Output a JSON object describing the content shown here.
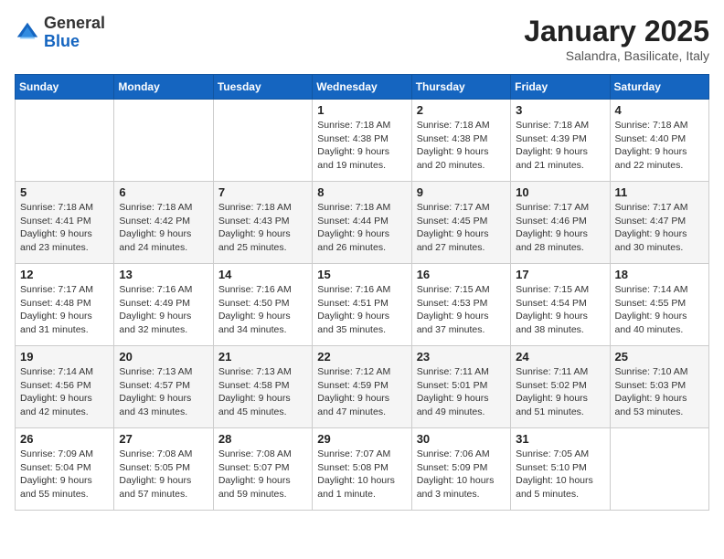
{
  "logo": {
    "general": "General",
    "blue": "Blue"
  },
  "title": "January 2025",
  "subtitle": "Salandra, Basilicate, Italy",
  "days_of_week": [
    "Sunday",
    "Monday",
    "Tuesday",
    "Wednesday",
    "Thursday",
    "Friday",
    "Saturday"
  ],
  "weeks": [
    [
      {
        "day": "",
        "info": ""
      },
      {
        "day": "",
        "info": ""
      },
      {
        "day": "",
        "info": ""
      },
      {
        "day": "1",
        "info": "Sunrise: 7:18 AM\nSunset: 4:38 PM\nDaylight: 9 hours\nand 19 minutes."
      },
      {
        "day": "2",
        "info": "Sunrise: 7:18 AM\nSunset: 4:38 PM\nDaylight: 9 hours\nand 20 minutes."
      },
      {
        "day": "3",
        "info": "Sunrise: 7:18 AM\nSunset: 4:39 PM\nDaylight: 9 hours\nand 21 minutes."
      },
      {
        "day": "4",
        "info": "Sunrise: 7:18 AM\nSunset: 4:40 PM\nDaylight: 9 hours\nand 22 minutes."
      }
    ],
    [
      {
        "day": "5",
        "info": "Sunrise: 7:18 AM\nSunset: 4:41 PM\nDaylight: 9 hours\nand 23 minutes."
      },
      {
        "day": "6",
        "info": "Sunrise: 7:18 AM\nSunset: 4:42 PM\nDaylight: 9 hours\nand 24 minutes."
      },
      {
        "day": "7",
        "info": "Sunrise: 7:18 AM\nSunset: 4:43 PM\nDaylight: 9 hours\nand 25 minutes."
      },
      {
        "day": "8",
        "info": "Sunrise: 7:18 AM\nSunset: 4:44 PM\nDaylight: 9 hours\nand 26 minutes."
      },
      {
        "day": "9",
        "info": "Sunrise: 7:17 AM\nSunset: 4:45 PM\nDaylight: 9 hours\nand 27 minutes."
      },
      {
        "day": "10",
        "info": "Sunrise: 7:17 AM\nSunset: 4:46 PM\nDaylight: 9 hours\nand 28 minutes."
      },
      {
        "day": "11",
        "info": "Sunrise: 7:17 AM\nSunset: 4:47 PM\nDaylight: 9 hours\nand 30 minutes."
      }
    ],
    [
      {
        "day": "12",
        "info": "Sunrise: 7:17 AM\nSunset: 4:48 PM\nDaylight: 9 hours\nand 31 minutes."
      },
      {
        "day": "13",
        "info": "Sunrise: 7:16 AM\nSunset: 4:49 PM\nDaylight: 9 hours\nand 32 minutes."
      },
      {
        "day": "14",
        "info": "Sunrise: 7:16 AM\nSunset: 4:50 PM\nDaylight: 9 hours\nand 34 minutes."
      },
      {
        "day": "15",
        "info": "Sunrise: 7:16 AM\nSunset: 4:51 PM\nDaylight: 9 hours\nand 35 minutes."
      },
      {
        "day": "16",
        "info": "Sunrise: 7:15 AM\nSunset: 4:53 PM\nDaylight: 9 hours\nand 37 minutes."
      },
      {
        "day": "17",
        "info": "Sunrise: 7:15 AM\nSunset: 4:54 PM\nDaylight: 9 hours\nand 38 minutes."
      },
      {
        "day": "18",
        "info": "Sunrise: 7:14 AM\nSunset: 4:55 PM\nDaylight: 9 hours\nand 40 minutes."
      }
    ],
    [
      {
        "day": "19",
        "info": "Sunrise: 7:14 AM\nSunset: 4:56 PM\nDaylight: 9 hours\nand 42 minutes."
      },
      {
        "day": "20",
        "info": "Sunrise: 7:13 AM\nSunset: 4:57 PM\nDaylight: 9 hours\nand 43 minutes."
      },
      {
        "day": "21",
        "info": "Sunrise: 7:13 AM\nSunset: 4:58 PM\nDaylight: 9 hours\nand 45 minutes."
      },
      {
        "day": "22",
        "info": "Sunrise: 7:12 AM\nSunset: 4:59 PM\nDaylight: 9 hours\nand 47 minutes."
      },
      {
        "day": "23",
        "info": "Sunrise: 7:11 AM\nSunset: 5:01 PM\nDaylight: 9 hours\nand 49 minutes."
      },
      {
        "day": "24",
        "info": "Sunrise: 7:11 AM\nSunset: 5:02 PM\nDaylight: 9 hours\nand 51 minutes."
      },
      {
        "day": "25",
        "info": "Sunrise: 7:10 AM\nSunset: 5:03 PM\nDaylight: 9 hours\nand 53 minutes."
      }
    ],
    [
      {
        "day": "26",
        "info": "Sunrise: 7:09 AM\nSunset: 5:04 PM\nDaylight: 9 hours\nand 55 minutes."
      },
      {
        "day": "27",
        "info": "Sunrise: 7:08 AM\nSunset: 5:05 PM\nDaylight: 9 hours\nand 57 minutes."
      },
      {
        "day": "28",
        "info": "Sunrise: 7:08 AM\nSunset: 5:07 PM\nDaylight: 9 hours\nand 59 minutes."
      },
      {
        "day": "29",
        "info": "Sunrise: 7:07 AM\nSunset: 5:08 PM\nDaylight: 10 hours\nand 1 minute."
      },
      {
        "day": "30",
        "info": "Sunrise: 7:06 AM\nSunset: 5:09 PM\nDaylight: 10 hours\nand 3 minutes."
      },
      {
        "day": "31",
        "info": "Sunrise: 7:05 AM\nSunset: 5:10 PM\nDaylight: 10 hours\nand 5 minutes."
      },
      {
        "day": "",
        "info": ""
      }
    ]
  ]
}
